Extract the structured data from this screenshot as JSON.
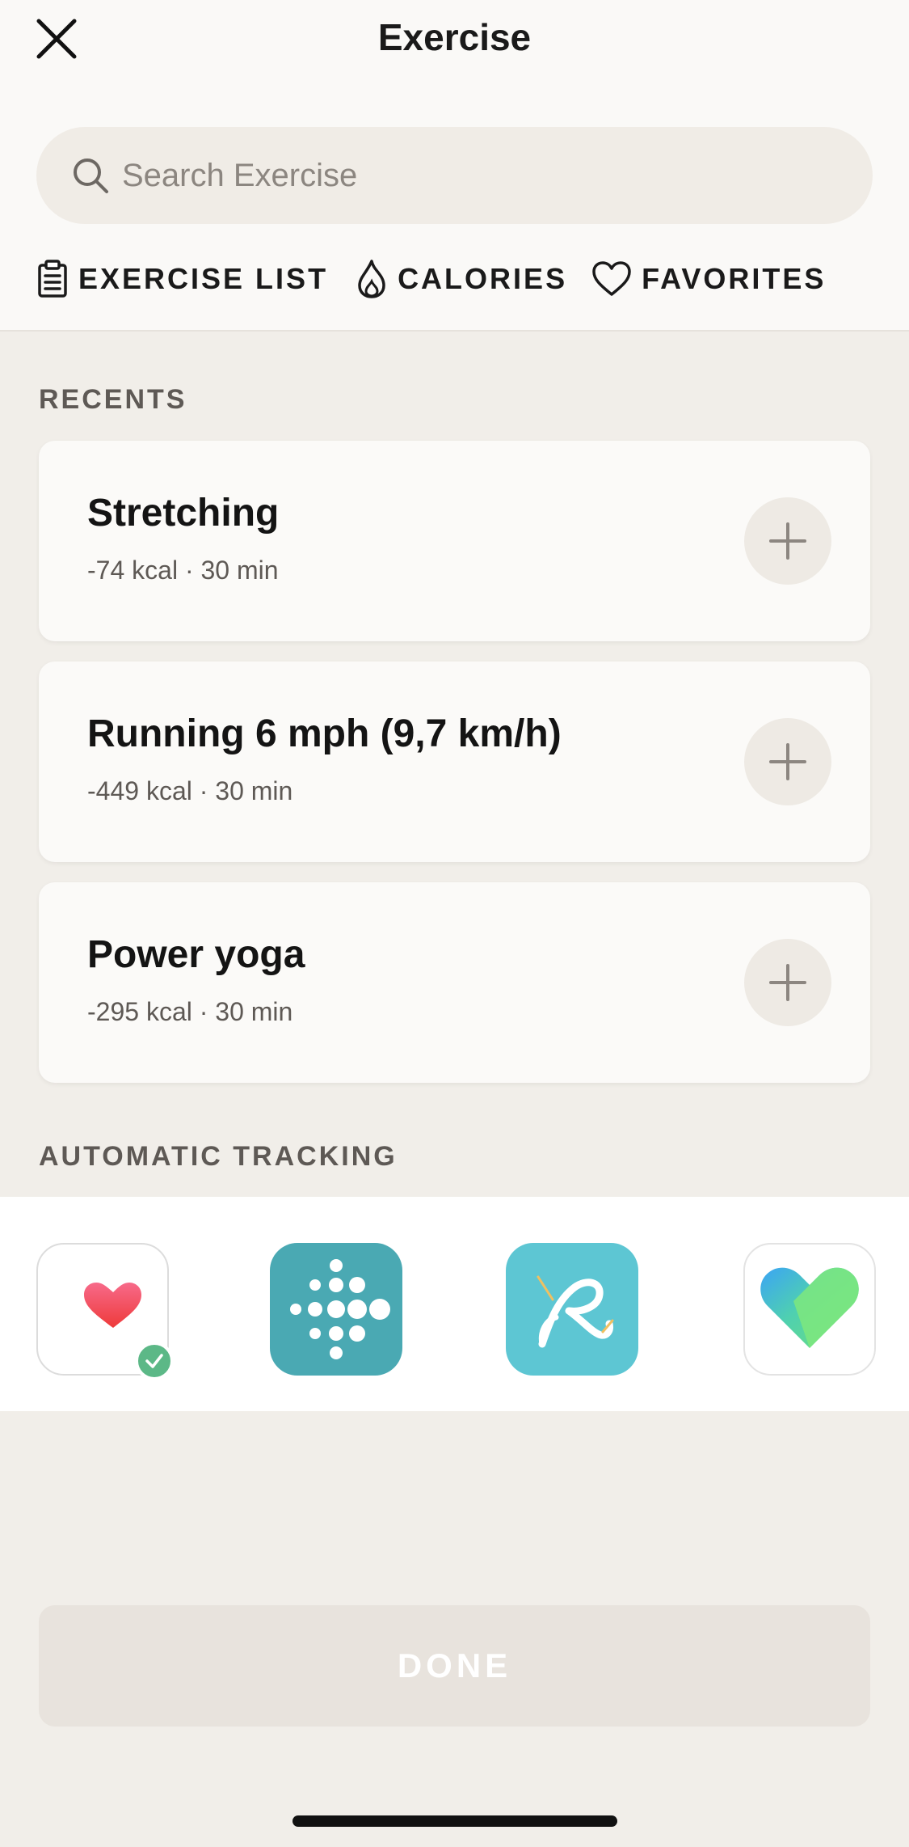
{
  "header": {
    "title": "Exercise",
    "close_icon": "close-icon"
  },
  "search": {
    "placeholder": "Search Exercise",
    "value": ""
  },
  "tabs": [
    {
      "label": "EXERCISE LIST",
      "icon": "clipboard-icon"
    },
    {
      "label": "CALORIES",
      "icon": "flame-icon"
    },
    {
      "label": "FAVORITES",
      "icon": "heart-outline-icon"
    }
  ],
  "recents": {
    "label": "RECENTS",
    "items": [
      {
        "name": "Stretching",
        "meta": "-74 kcal · 30 min"
      },
      {
        "name": "Running 6 mph (9,7 km/h)",
        "meta": "-449 kcal · 30 min"
      },
      {
        "name": "Power yoga",
        "meta": "-295 kcal · 30 min"
      }
    ]
  },
  "tracking": {
    "label": "AUTOMATIC TRACKING",
    "apps": [
      {
        "icon": "apple-health-icon",
        "connected": true
      },
      {
        "icon": "fitbit-icon",
        "connected": false
      },
      {
        "icon": "runkeeper-icon",
        "connected": false
      },
      {
        "icon": "google-fit-icon",
        "connected": false
      }
    ]
  },
  "footer": {
    "done_label": "DONE"
  },
  "colors": {
    "background": "#f1eee9",
    "card": "#fbfaf8",
    "accent_green": "#5cb887",
    "fitbit_teal": "#4aa9b3",
    "runkeeper_cyan": "#5dc6d3"
  }
}
